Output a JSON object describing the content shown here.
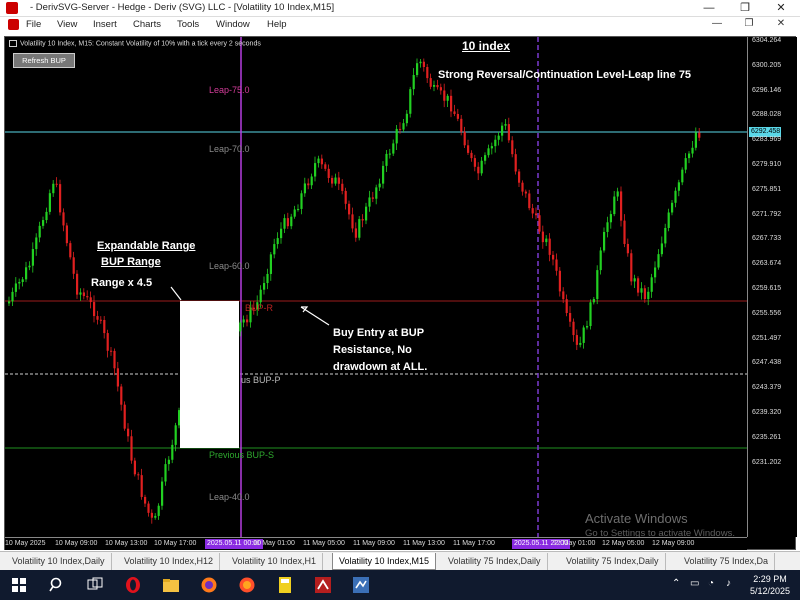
{
  "window": {
    "title": "- DerivSVG-Server - Hedge - Deriv (SVG) LLC - [Volatility 10 Index,M15]",
    "minimize": "—",
    "maximize": "❐",
    "close": "✕"
  },
  "menu": {
    "items": [
      "File",
      "View",
      "Insert",
      "Charts",
      "Tools",
      "Window",
      "Help"
    ],
    "mdi_minimize": "—",
    "mdi_restore": "❐",
    "mdi_close": "✕"
  },
  "chart": {
    "header": "Volatility 10 Index, M15:  Constant Volatility of 10% with a tick every 2 seconds",
    "refresh_button": "Refresh BUP",
    "price_labels": [
      "6304.264",
      "6300.205",
      "6296.146",
      "6288.028",
      "6283.969",
      "6279.910",
      "6275.851",
      "6271.792",
      "6267.733",
      "6263.674",
      "6259.615",
      "6255.556",
      "6251.497",
      "6247.438",
      "6243.379",
      "6239.320",
      "6235.261",
      "6231.202"
    ],
    "current_price": "6292.458",
    "time_labels": [
      "10 May 2025",
      "10 May 09:00",
      "10 May 13:00",
      "10 May 17:00",
      "10 May 21:00",
      "11 May 01:00",
      "11 May 05:00",
      "11 May 09:00",
      "11 May 13:00",
      "11 May 17:00",
      "11 May 21:00",
      "12 May 01:00",
      "12 May 05:00",
      "12 May 09:00"
    ],
    "time_highlight_1": "2025.05.11 00:00",
    "time_highlight_2": "2025.05.11 22:00",
    "leap_labels": {
      "leap75": "Leap-75.0",
      "leap70": "Leap-70.0",
      "leap60": "Leap-60.0",
      "leap40": "Leap-40.0"
    },
    "bup_r": "BUP-R",
    "bup_p": "us BUP-P",
    "bup_s": "Previous BUP-S",
    "annotations": {
      "title": "10 index",
      "strong": "Strong Reversal/Continuation Level-Leap line 75",
      "expandable": "Expandable Range",
      "bup_range": "BUP Range",
      "range_mult": "Range x 4.5",
      "buy_entry": "Buy Entry at BUP Resistance, No drawdown at ALL."
    },
    "watermark": {
      "line1": "Activate Windows",
      "line2": "Go to Settings to activate Windows."
    },
    "colors": {
      "bull": "#22d022",
      "bear": "#e02020",
      "resistance": "#9b1b1b",
      "support": "#1f8f1f",
      "current_line": "#5ad7e8",
      "vertical": "#b53ee0"
    }
  },
  "tabs": [
    "Volatility 10 Index,Daily",
    "Volatility 10 Index,H12",
    "Volatility 10 Index,H1",
    "Volatility 10 Index,M15",
    "Volatility 75 Index,Daily",
    "Volatility 75 Index,Daily",
    "Volatility 75 Index,Da"
  ],
  "active_tab": "Volatility 10 Index,M15",
  "taskbar": {
    "time": "2:29 PM",
    "date": "5/12/2025",
    "icons": [
      "windows-start",
      "search",
      "task-view",
      "opera",
      "file-explorer",
      "firefox",
      "firefox-alt",
      "sticky-app",
      "deriv-mt5",
      "mt5-alt"
    ]
  }
}
